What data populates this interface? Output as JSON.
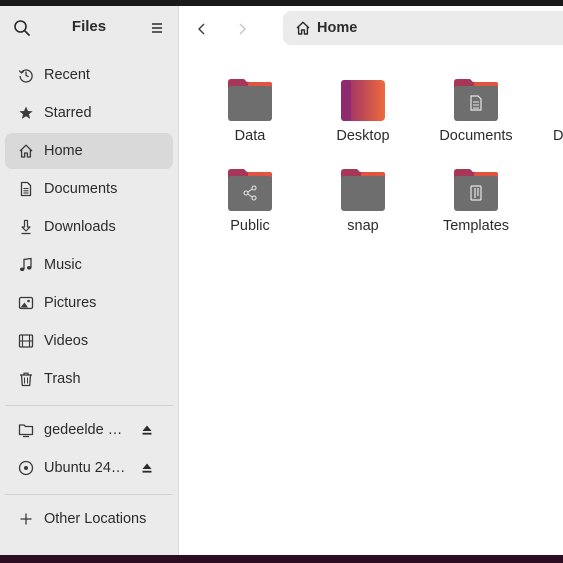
{
  "app": {
    "title": "Files"
  },
  "sidebar": {
    "items": [
      {
        "label": "Recent",
        "icon": "recent-icon"
      },
      {
        "label": "Starred",
        "icon": "star-icon"
      },
      {
        "label": "Home",
        "icon": "home-icon",
        "active": true
      },
      {
        "label": "Documents",
        "icon": "document-icon"
      },
      {
        "label": "Downloads",
        "icon": "download-icon"
      },
      {
        "label": "Music",
        "icon": "music-icon"
      },
      {
        "label": "Pictures",
        "icon": "picture-icon"
      },
      {
        "label": "Videos",
        "icon": "video-icon"
      },
      {
        "label": "Trash",
        "icon": "trash-icon"
      }
    ],
    "devices": [
      {
        "label": "gedeelde …",
        "icon": "shared-folder-icon"
      },
      {
        "label": "Ubuntu 24…",
        "icon": "disc-icon"
      }
    ],
    "other_locations": "Other Locations"
  },
  "pathbar": {
    "current": "Home"
  },
  "files": [
    {
      "name": "Data",
      "icon": "folder-icon"
    },
    {
      "name": "Desktop",
      "icon": "desktop-folder-icon"
    },
    {
      "name": "Documents",
      "icon": "documents-folder-icon"
    },
    {
      "name": "D",
      "icon": "folder-icon"
    },
    {
      "name": "Public",
      "icon": "public-folder-icon"
    },
    {
      "name": "snap",
      "icon": "folder-icon"
    },
    {
      "name": "Templates",
      "icon": "templates-folder-icon"
    }
  ],
  "colors": {
    "folder_back": "#a83658",
    "folder_tab": "#e0553f",
    "folder_front": "#6e6e6e",
    "desktop_left": "#8e2a6e",
    "desktop_right": "#ee6a3d"
  }
}
